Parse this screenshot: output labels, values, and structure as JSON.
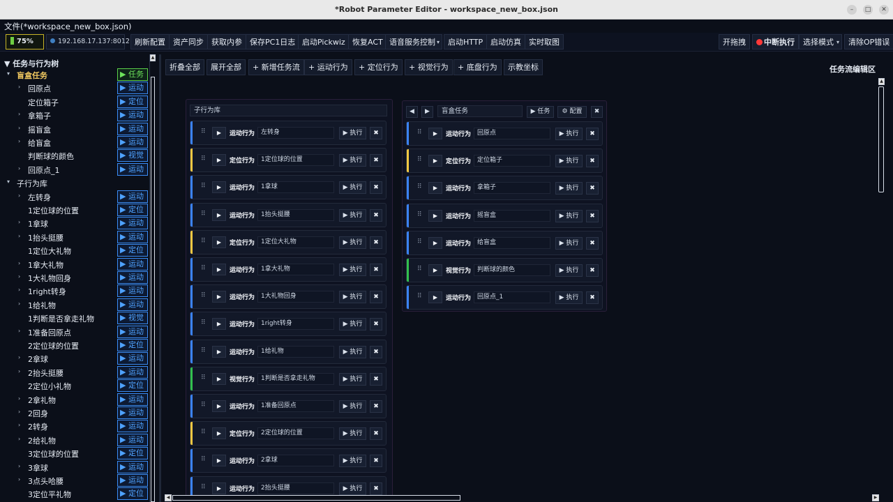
{
  "window": {
    "title": "*Robot Parameter Editor - workspace_new_box.json"
  },
  "menubar": {
    "file_menu": "文件(*workspace_new_box.json)"
  },
  "status": {
    "battery": "75%",
    "ip": "192.168.17.137:8012",
    "battery_color": "#6fce43"
  },
  "toolbar": {
    "left": [
      "刷新配置",
      "资产同步",
      "获取内参",
      "保存PC1日志",
      "启动Pickwiz",
      "恢复ACT",
      "语音服务控制",
      "启动HTTP",
      "启动仿真",
      "实时取图"
    ],
    "voice_dropdown_icon": "chevron-down-icon",
    "right": {
      "drag": "开拖拽",
      "abort": "中断执行",
      "select_mode": "选择模式",
      "clear_errors": "清除OP错误"
    }
  },
  "tree": {
    "header": "▼ 任务与行为树",
    "rows": [
      {
        "label": "盲盒任务",
        "badge": "▶ 任务",
        "level": 0,
        "arrow": "▾",
        "badge_kind": "task",
        "top": true
      },
      {
        "label": "回原点",
        "badge": "▶ 运动",
        "level": 1,
        "arrow": "›"
      },
      {
        "label": "定位箱子",
        "badge": "▶ 定位",
        "level": 1,
        "arrow": ""
      },
      {
        "label": "拿箱子",
        "badge": "▶ 运动",
        "level": 1,
        "arrow": "›"
      },
      {
        "label": "摇盲盒",
        "badge": "▶ 运动",
        "level": 1,
        "arrow": "›"
      },
      {
        "label": "给盲盒",
        "badge": "▶ 运动",
        "level": 1,
        "arrow": "›"
      },
      {
        "label": "判断球的颜色",
        "badge": "▶ 视觉",
        "level": 1,
        "arrow": ""
      },
      {
        "label": "回原点_1",
        "badge": "▶ 运动",
        "level": 1,
        "arrow": "›"
      },
      {
        "label": "子行为库",
        "badge": "",
        "level": 0,
        "arrow": "▾"
      },
      {
        "label": "左转身",
        "badge": "▶ 运动",
        "level": 1,
        "arrow": "›"
      },
      {
        "label": "1定位球的位置",
        "badge": "▶ 定位",
        "level": 1,
        "arrow": ""
      },
      {
        "label": "1拿球",
        "badge": "▶ 运动",
        "level": 1,
        "arrow": "›"
      },
      {
        "label": "1抬头挺腰",
        "badge": "▶ 运动",
        "level": 1,
        "arrow": "›"
      },
      {
        "label": "1定位大礼物",
        "badge": "▶ 定位",
        "level": 1,
        "arrow": ""
      },
      {
        "label": "1拿大礼物",
        "badge": "▶ 运动",
        "level": 1,
        "arrow": "›"
      },
      {
        "label": "1大礼物回身",
        "badge": "▶ 运动",
        "level": 1,
        "arrow": "›"
      },
      {
        "label": "1right转身",
        "badge": "▶ 运动",
        "level": 1,
        "arrow": "›"
      },
      {
        "label": "1给礼物",
        "badge": "▶ 运动",
        "level": 1,
        "arrow": "›"
      },
      {
        "label": "1判断是否拿走礼物",
        "badge": "▶ 视觉",
        "level": 1,
        "arrow": ""
      },
      {
        "label": "1准备回原点",
        "badge": "▶ 运动",
        "level": 1,
        "arrow": "›"
      },
      {
        "label": "2定位球的位置",
        "badge": "▶ 定位",
        "level": 1,
        "arrow": ""
      },
      {
        "label": "2拿球",
        "badge": "▶ 运动",
        "level": 1,
        "arrow": "›"
      },
      {
        "label": "2抬头挺腰",
        "badge": "▶ 运动",
        "level": 1,
        "arrow": "›"
      },
      {
        "label": "2定位小礼物",
        "badge": "▶ 定位",
        "level": 1,
        "arrow": ""
      },
      {
        "label": "2拿礼物",
        "badge": "▶ 运动",
        "level": 1,
        "arrow": "›"
      },
      {
        "label": "2回身",
        "badge": "▶ 运动",
        "level": 1,
        "arrow": "›"
      },
      {
        "label": "2转身",
        "badge": "▶ 运动",
        "level": 1,
        "arrow": "›"
      },
      {
        "label": "2给礼物",
        "badge": "▶ 运动",
        "level": 1,
        "arrow": "›"
      },
      {
        "label": "3定位球的位置",
        "badge": "▶ 定位",
        "level": 1,
        "arrow": ""
      },
      {
        "label": "3拿球",
        "badge": "▶ 运动",
        "level": 1,
        "arrow": "›"
      },
      {
        "label": "3点头哈腰",
        "badge": "▶ 运动",
        "level": 1,
        "arrow": "›"
      },
      {
        "label": "3定位平礼物",
        "badge": "▶ 定位",
        "level": 1,
        "arrow": ""
      }
    ]
  },
  "canvas_toolbar": {
    "buttons": [
      "折叠全部",
      "展开全部",
      "+ 新增任务流",
      "+ 运动行为",
      "+ 定位行为",
      "+ 视觉行为",
      "+ 底盘行为",
      "示教坐标"
    ],
    "editor_label": "任务流编辑区"
  },
  "library_column": {
    "header": "子行为库",
    "cards": [
      {
        "type": "运动行为",
        "name": "左转身",
        "color": "blue"
      },
      {
        "type": "定位行为",
        "name": "1定位球的位置",
        "color": "yellow"
      },
      {
        "type": "运动行为",
        "name": "1拿球",
        "color": "blue"
      },
      {
        "type": "运动行为",
        "name": "1抬头挺腰",
        "color": "blue"
      },
      {
        "type": "定位行为",
        "name": "1定位大礼物",
        "color": "yellow"
      },
      {
        "type": "运动行为",
        "name": "1拿大礼物",
        "color": "blue"
      },
      {
        "type": "运动行为",
        "name": "1大礼物回身",
        "color": "blue"
      },
      {
        "type": "运动行为",
        "name": "1right转身",
        "color": "blue"
      },
      {
        "type": "运动行为",
        "name": "1给礼物",
        "color": "blue"
      },
      {
        "type": "视觉行为",
        "name": "1判断是否拿走礼物",
        "color": "green"
      },
      {
        "type": "运动行为",
        "name": "1准备回原点",
        "color": "blue"
      },
      {
        "type": "定位行为",
        "name": "2定位球的位置",
        "color": "yellow"
      },
      {
        "type": "运动行为",
        "name": "2拿球",
        "color": "blue"
      },
      {
        "type": "运动行为",
        "name": "2抬头挺腰",
        "color": "blue"
      }
    ]
  },
  "task_column": {
    "nav_prev": "◀",
    "nav_next": "▶",
    "header": "盲盒任务",
    "task_button": "▶ 任务",
    "config_button": "⚙ 配置",
    "close_button": "✖",
    "cards": [
      {
        "type": "运动行为",
        "name": "回原点",
        "color": "blue"
      },
      {
        "type": "定位行为",
        "name": "定位箱子",
        "color": "yellow"
      },
      {
        "type": "运动行为",
        "name": "拿箱子",
        "color": "blue"
      },
      {
        "type": "运动行为",
        "name": "摇盲盒",
        "color": "blue"
      },
      {
        "type": "运动行为",
        "name": "给盲盒",
        "color": "blue"
      },
      {
        "type": "视觉行为",
        "name": "判断球的颜色",
        "color": "green"
      },
      {
        "type": "运动行为",
        "name": "回原点_1",
        "color": "blue"
      }
    ]
  },
  "card_controls": {
    "exec": "▶ 执行",
    "close": "✖",
    "play": "▶",
    "grip": "⠿"
  },
  "colors": {
    "motion": "#3b82f6",
    "locate": "#f5c842",
    "vision": "#32c04e",
    "badge_text": "#4fa2ff",
    "task_badge": "#6de25c"
  }
}
